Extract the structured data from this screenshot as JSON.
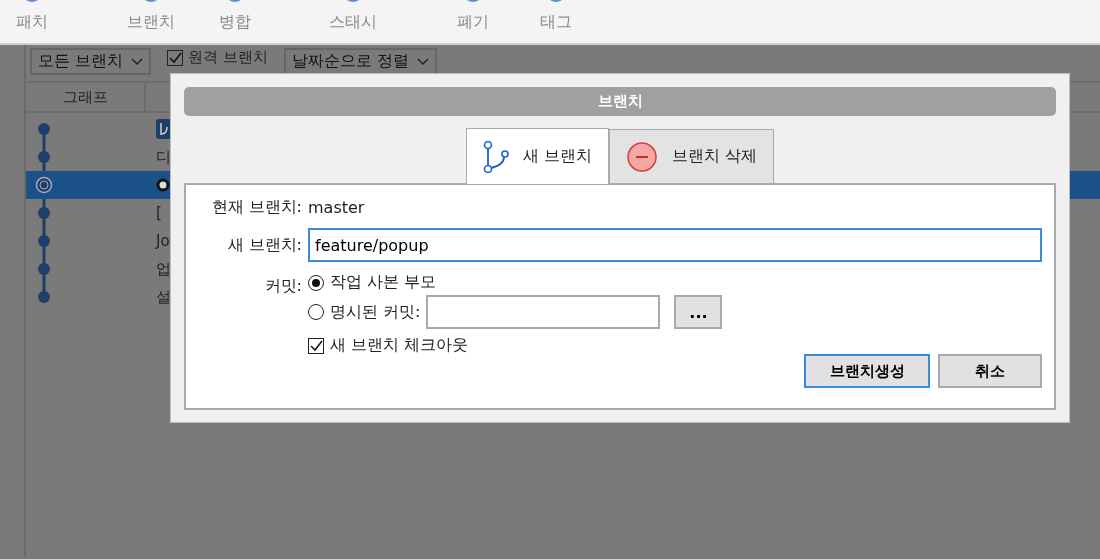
{
  "toolbar": [
    {
      "label": "패치"
    },
    {
      "label": "브랜치"
    },
    {
      "label": "병합"
    },
    {
      "label": "스태시"
    },
    {
      "label": "폐기"
    },
    {
      "label": "태그"
    }
  ],
  "filter_bar": {
    "branch_filter": "모든 브랜치",
    "remote_checkbox": {
      "label": "원격 브랜치",
      "checked": true
    },
    "sort": "날짜순으로 정렬"
  },
  "history": {
    "columns": [
      "그래프"
    ],
    "commits": [
      {
        "kind": "branch-badge",
        "selected": false
      },
      {
        "text": "디",
        "kind": "plain",
        "selected": false
      },
      {
        "kind": "working-copy",
        "selected": true
      },
      {
        "text": "[",
        "kind": "plain",
        "selected": false
      },
      {
        "text": "Jo",
        "kind": "plain",
        "selected": false
      },
      {
        "text": "업",
        "kind": "plain",
        "selected": false
      },
      {
        "text": "설",
        "kind": "plain",
        "selected": false
      }
    ]
  },
  "dialog": {
    "title": "브랜치",
    "tabs": [
      {
        "label": "새 브랜치",
        "kind": "new",
        "selected": true
      },
      {
        "label": "브랜치 삭제",
        "kind": "delete",
        "selected": false
      }
    ],
    "current_branch": {
      "label": "현재 브랜치:",
      "value": "master"
    },
    "new_branch": {
      "label": "새 브랜치:",
      "value": "feature/popup"
    },
    "commit": {
      "label": "커밋:",
      "options": [
        {
          "label": "작업 사본 부모",
          "selected": true
        },
        {
          "label": "명시된 커밋:",
          "selected": false
        }
      ],
      "browse_button": "..."
    },
    "checkout": {
      "label": "새 브랜치 체크아웃",
      "checked": true
    },
    "buttons": [
      {
        "label": "브랜치생성",
        "default": true
      },
      {
        "label": "취소",
        "default": false
      }
    ]
  }
}
